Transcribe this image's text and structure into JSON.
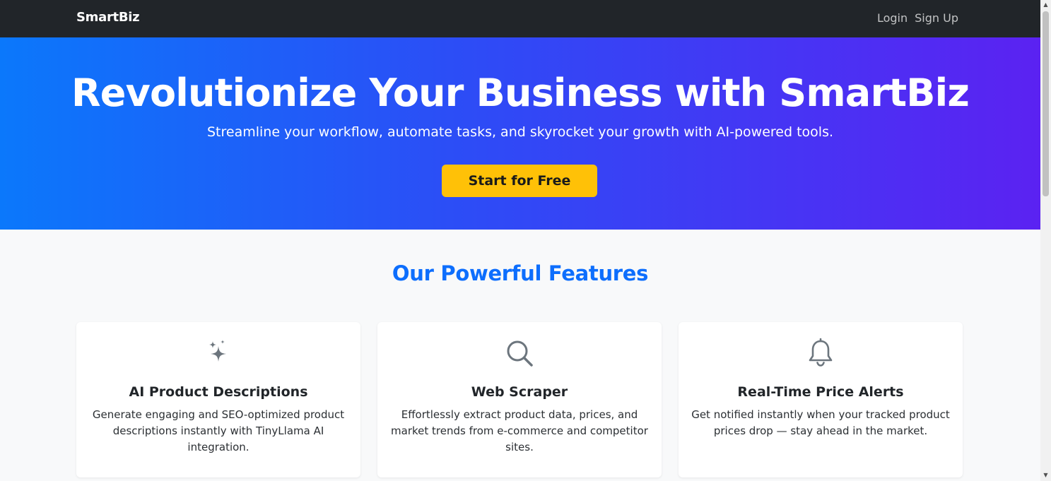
{
  "navbar": {
    "brand": "SmartBiz",
    "links": [
      "Login",
      "Sign Up"
    ]
  },
  "hero": {
    "title": "Revolutionize Your Business with SmartBiz",
    "subtitle": "Streamline your workflow, automate tasks, and skyrocket your growth with AI-powered tools.",
    "cta_label": "Start for Free"
  },
  "features": {
    "title": "Our Powerful Features",
    "cards": [
      {
        "icon": "sparkles-icon",
        "title": "AI Product Descriptions",
        "text": "Generate engaging and SEO-optimized product descriptions instantly with TinyLlama AI integration."
      },
      {
        "icon": "search-icon",
        "title": "Web Scraper",
        "text": "Effortlessly extract product data, prices, and market trends from e-commerce and competitor sites."
      },
      {
        "icon": "bell-icon",
        "title": "Real-Time Price Alerts",
        "text": "Get notified instantly when your tracked product prices drop — stay ahead in the market."
      }
    ]
  },
  "colors": {
    "navbar_bg": "#212529",
    "hero_gradient_start": "#0b78fb",
    "hero_gradient_end": "#5b22f2",
    "cta_bg": "#ffc107",
    "accent": "#0d6efd"
  }
}
